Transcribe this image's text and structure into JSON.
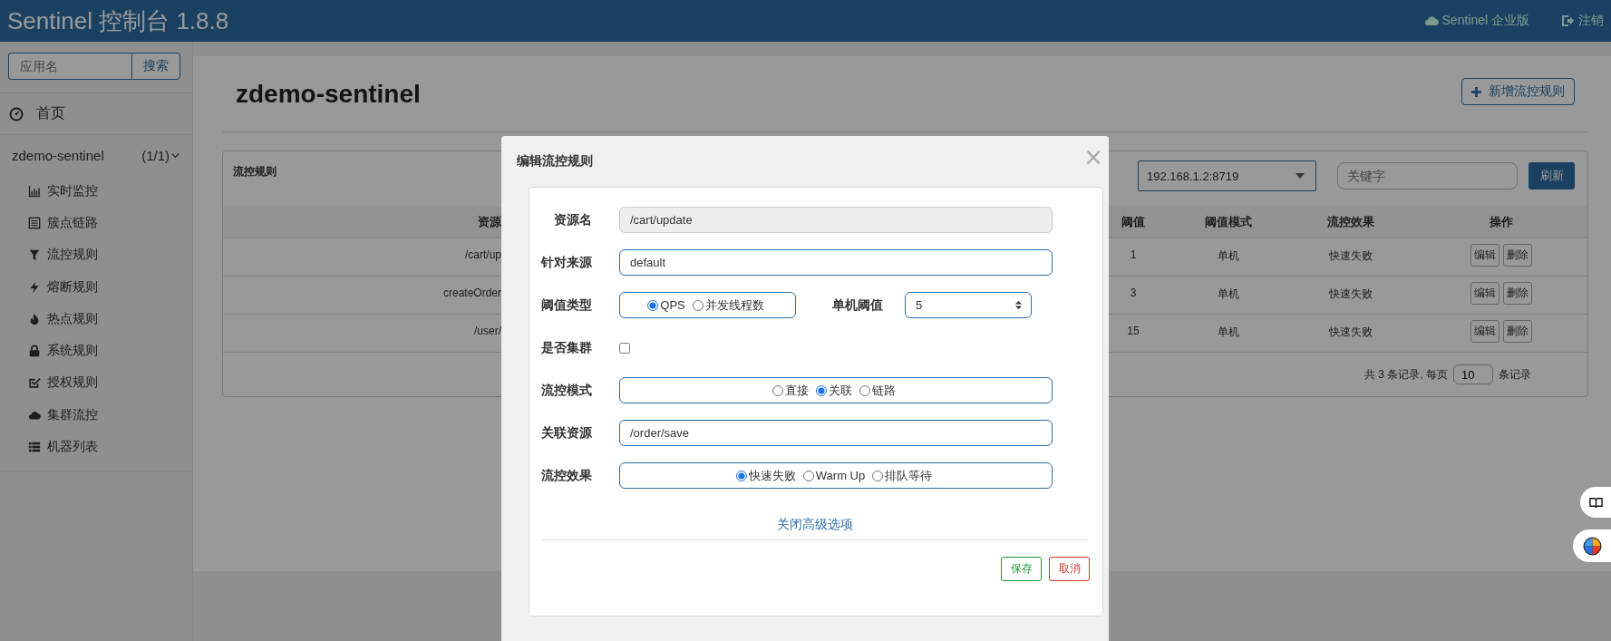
{
  "header": {
    "title": "Sentinel 控制台 1.8.8",
    "links": [
      {
        "kind": "cloud",
        "label": "Sentinel 企业版"
      },
      {
        "kind": "logout",
        "label": "注销"
      }
    ]
  },
  "sidebar": {
    "search": {
      "placeholder": "应用名",
      "button": "搜索"
    },
    "home": "首页",
    "app": {
      "name": "zdemo-sentinel",
      "count": "(1/1)",
      "expanded": true,
      "items": [
        {
          "kind": "chart",
          "label": "实时监控"
        },
        {
          "kind": "list",
          "label": "簇点链路"
        },
        {
          "kind": "filter",
          "label": "流控规则"
        },
        {
          "kind": "bolt",
          "label": "熔断规则"
        },
        {
          "kind": "fire",
          "label": "热点规则"
        },
        {
          "kind": "lock",
          "label": "系统规则"
        },
        {
          "kind": "check",
          "label": "授权规则"
        },
        {
          "kind": "cloud",
          "label": "集群流控"
        },
        {
          "kind": "table",
          "label": "机器列表"
        }
      ]
    }
  },
  "main": {
    "title": "zdemo-sentinel",
    "add_button": "新增流控规则",
    "panel": {
      "title": "流控规则",
      "machine": "192.168.1.2:8719",
      "keyword_placeholder": "关键字",
      "refresh": "刷新",
      "columns": [
        "资源",
        "阈值",
        "阈值模式",
        "流控效果",
        "操作"
      ],
      "rows": [
        {
          "resource": "/cart/up",
          "threshold": "1",
          "mode": "单机",
          "effect": "快速失败",
          "actions": [
            "编辑",
            "删除"
          ]
        },
        {
          "resource": "createOrder",
          "threshold": "3",
          "mode": "单机",
          "effect": "快速失败",
          "actions": [
            "编辑",
            "删除"
          ]
        },
        {
          "resource": "/user/",
          "threshold": "15",
          "mode": "单机",
          "effect": "快速失败",
          "actions": [
            "编辑",
            "删除"
          ]
        }
      ],
      "pagination": {
        "prefix": "共 3 条记录, 每页",
        "page_size": "10",
        "suffix": "条记录"
      }
    }
  },
  "dialog": {
    "title": "编辑流控规则",
    "close": "×",
    "fields": [
      {
        "kind": "text",
        "label": "资源名",
        "value": "/cart/update",
        "disabled": true
      },
      {
        "kind": "text",
        "label": "针对来源",
        "value": "default",
        "disabled": false
      },
      {
        "kind": "threshold",
        "label": "阈值类型",
        "options": [
          {
            "label": "QPS",
            "selected": true
          },
          {
            "label": "并发线程数",
            "selected": false
          }
        ],
        "number_label": "单机阈值",
        "number_value": "5"
      },
      {
        "kind": "checkbox",
        "label": "是否集群",
        "checked": false
      },
      {
        "kind": "radio",
        "label": "流控模式",
        "options": [
          {
            "label": "直接",
            "selected": false
          },
          {
            "label": "关联",
            "selected": true
          },
          {
            "label": "链路",
            "selected": false
          }
        ]
      },
      {
        "kind": "text",
        "label": "关联资源",
        "value": "/order/save",
        "disabled": false
      },
      {
        "kind": "radio",
        "label": "流控效果",
        "options": [
          {
            "label": "快速失败",
            "selected": true
          },
          {
            "label": "Warm Up",
            "selected": false
          },
          {
            "label": "排队等待",
            "selected": false
          }
        ]
      }
    ],
    "toggle_link": "关闭高级选项",
    "buttons": [
      {
        "kind": "save",
        "label": "保存"
      },
      {
        "kind": "cancel",
        "label": "取消"
      }
    ]
  }
}
